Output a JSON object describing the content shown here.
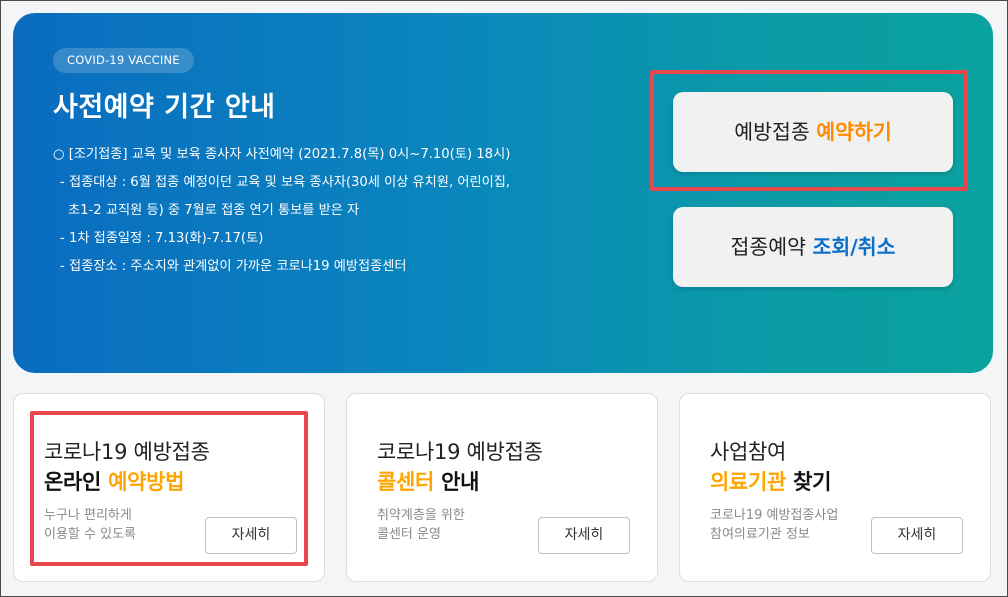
{
  "hero": {
    "badge": "COVID-19 VACCINE",
    "title": "사전예약 기간 안내",
    "info_lines": [
      "○ [조기접종] 교육 및 보육 종사자 사전예약 (2021.7.8(목) 0시~7.10(토) 18시)",
      "- 접종대상 : 6월 접종 예정이던 교육 및 보육 종사자(30세 이상 유치원, 어린이집,",
      "초1-2 교직원 등) 중 7월로 접종 연기 통보를 받은 자",
      "- 1차 접종일정 : 7.13(화)-7.17(토)",
      "- 접종장소 : 주소지와 관계없이 가까운 코로나19 예방접종센터"
    ],
    "reserve_button": {
      "prefix": "예방접종",
      "highlight": "예약하기"
    },
    "lookup_button": {
      "prefix": "접종예약",
      "highlight": "조회/취소"
    }
  },
  "cards": [
    {
      "line1": "코로나19 예방접종",
      "line2_plain_before": "온라인 ",
      "line2_accent": "예약방법",
      "line2_plain_after": "",
      "desc": [
        "누구나 편리하게",
        "이용할 수 있도록"
      ],
      "button": "자세히"
    },
    {
      "line1": "코로나19 예방접종",
      "line2_plain_before": "",
      "line2_accent": "콜센터",
      "line2_plain_after": " 안내",
      "desc": [
        "취약계층을 위한",
        "콜센터 운영"
      ],
      "button": "자세히"
    },
    {
      "line1": "사업참여",
      "line2_plain_before": "",
      "line2_accent": "의료기관",
      "line2_plain_after": " 찾기",
      "desc": [
        "코로나19 예방접종사업",
        "참여의료기관 정보"
      ],
      "button": "자세히"
    }
  ],
  "colors": {
    "accent_orange": "#ff8a00",
    "accent_blue": "#0a6fc9",
    "highlight_box": "#e8474e",
    "hero_gradient_start": "#0a6cc0",
    "hero_gradient_end": "#0aa29e"
  }
}
